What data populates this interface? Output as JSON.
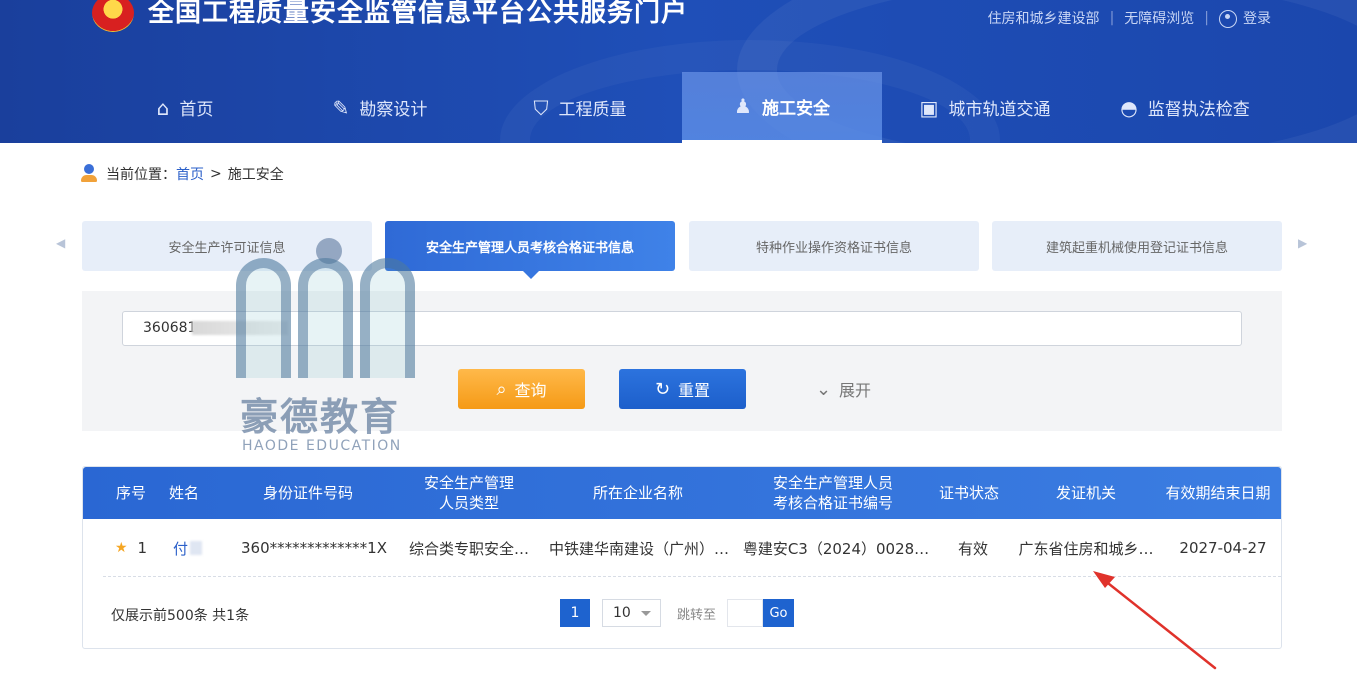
{
  "header": {
    "site_title": "全国工程质量安全监管信息平台公共服务门户",
    "top_links": [
      "住房和城乡建设部",
      "无障碍浏览"
    ],
    "login_label": "登录"
  },
  "nav": {
    "items": [
      {
        "label": "首页",
        "icon": "home-icon"
      },
      {
        "label": "勘察设计",
        "icon": "design-tools-icon"
      },
      {
        "label": "工程质量",
        "icon": "shield-icon"
      },
      {
        "label": "施工安全",
        "icon": "worker-icon"
      },
      {
        "label": "城市轨道交通",
        "icon": "train-icon"
      },
      {
        "label": "监督执法检查",
        "icon": "officer-cap-icon"
      }
    ],
    "active": "施工安全"
  },
  "breadcrumb": {
    "prefix": "当前位置：",
    "home": "首页",
    "separator": ">",
    "current": "施工安全"
  },
  "tabs": [
    {
      "label": "安全生产许可证信息"
    },
    {
      "label": "安全生产管理人员考核合格证书信息"
    },
    {
      "label": "特种作业操作资格证书信息"
    },
    {
      "label": "建筑起重机械使用登记证书信息"
    }
  ],
  "search": {
    "value": "360681",
    "query_label": "查询",
    "reset_label": "重置",
    "expand_label": "展开"
  },
  "watermark": {
    "text": "豪德教育",
    "sub": "HAODE EDUCATION"
  },
  "table": {
    "headers": [
      "序号",
      "姓名",
      "身份证件号码",
      "安全生产管理\n人员类型",
      "所在企业名称",
      "安全生产管理人员\n考核合格证书编号",
      "证书状态",
      "发证机关",
      "有效期结束日期"
    ],
    "rows": [
      {
        "index": "1",
        "name": "付",
        "id_number": "360*************1X",
        "type": "综合类专职安全…",
        "company": "中铁建华南建设（广州）…",
        "cert_no": "粤建安C3（2024）0028…",
        "status": "有效",
        "issuer": "广东省住房和城乡…",
        "expiry": "2027-04-27"
      }
    ]
  },
  "pagination": {
    "info": "仅展示前500条  共1条",
    "current_page": "1",
    "page_size": "10",
    "jump_label": "跳转至",
    "go_label": "Go"
  },
  "colors": {
    "header_blue": "#1f4fb8",
    "accent_blue": "#2a67d3",
    "query_orange": "#f59a16",
    "annotation_red": "#e0322b"
  }
}
